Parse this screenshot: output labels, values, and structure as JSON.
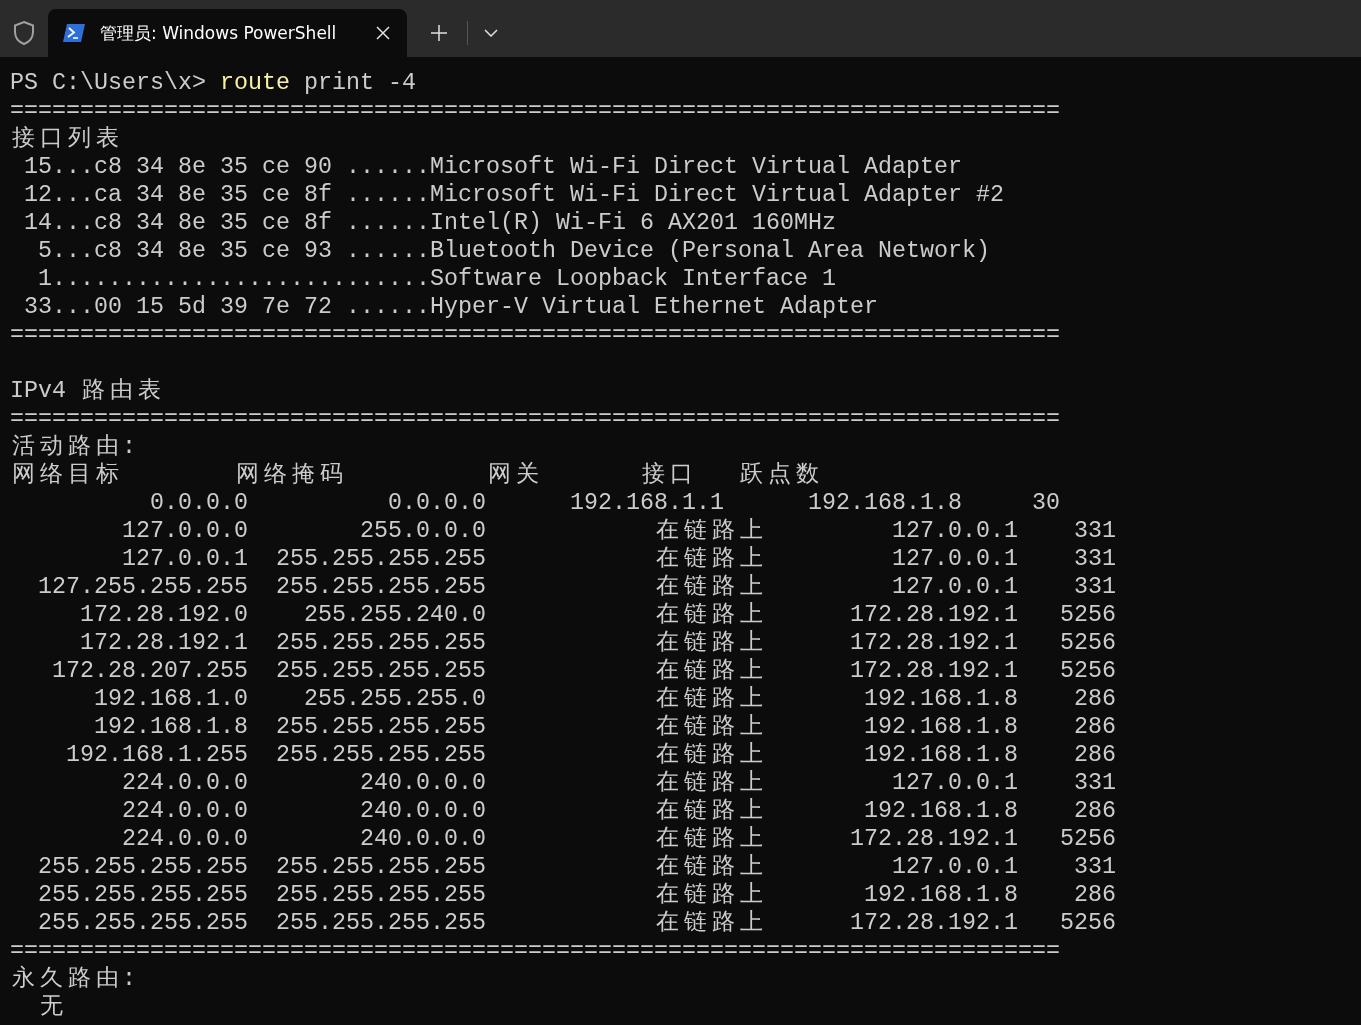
{
  "tabs": [
    {
      "title": "管理员: Windows PowerShell",
      "selected": true
    }
  ],
  "prompt": {
    "path": "PS C:\\Users\\x>",
    "command": "route",
    "args": "print -4"
  },
  "output": [
    {
      "kind": "text",
      "text": "==========================================================================="
    },
    {
      "kind": "text",
      "text": "接口列表"
    },
    {
      "kind": "text",
      "text": " 15...c8 34 8e 35 ce 90 ......Microsoft Wi-Fi Direct Virtual Adapter"
    },
    {
      "kind": "text",
      "text": " 12...ca 34 8e 35 ce 8f ......Microsoft Wi-Fi Direct Virtual Adapter #2"
    },
    {
      "kind": "text",
      "text": " 14...c8 34 8e 35 ce 8f ......Intel(R) Wi-Fi 6 AX201 160MHz"
    },
    {
      "kind": "text",
      "text": "  5...c8 34 8e 35 ce 93 ......Bluetooth Device (Personal Area Network)"
    },
    {
      "kind": "text",
      "text": "  1...........................Software Loopback Interface 1"
    },
    {
      "kind": "text",
      "text": " 33...00 15 5d 39 7e 72 ......Hyper-V Virtual Ethernet Adapter"
    },
    {
      "kind": "text",
      "text": "==========================================================================="
    },
    {
      "kind": "blank"
    },
    {
      "kind": "text",
      "text": "IPv4 路由表"
    },
    {
      "kind": "text",
      "text": "==========================================================================="
    },
    {
      "kind": "text",
      "text": "活动路由:"
    },
    {
      "kind": "header",
      "cells": [
        "网络目标",
        "网络掩码",
        "网关",
        "接口",
        "跃点数"
      ]
    },
    {
      "kind": "text",
      "text": "          0.0.0.0          0.0.0.0      192.168.1.1      192.168.1.8     30"
    },
    {
      "kind": "text",
      "text": "        127.0.0.0        255.0.0.0            在链路上         127.0.0.1    331"
    },
    {
      "kind": "text",
      "text": "        127.0.0.1  255.255.255.255            在链路上         127.0.0.1    331"
    },
    {
      "kind": "text",
      "text": "  127.255.255.255  255.255.255.255            在链路上         127.0.0.1    331"
    },
    {
      "kind": "text",
      "text": "     172.28.192.0    255.255.240.0            在链路上      172.28.192.1   5256"
    },
    {
      "kind": "text",
      "text": "     172.28.192.1  255.255.255.255            在链路上      172.28.192.1   5256"
    },
    {
      "kind": "text",
      "text": "   172.28.207.255  255.255.255.255            在链路上      172.28.192.1   5256"
    },
    {
      "kind": "text",
      "text": "      192.168.1.0    255.255.255.0            在链路上       192.168.1.8    286"
    },
    {
      "kind": "text",
      "text": "      192.168.1.8  255.255.255.255            在链路上       192.168.1.8    286"
    },
    {
      "kind": "text",
      "text": "    192.168.1.255  255.255.255.255            在链路上       192.168.1.8    286"
    },
    {
      "kind": "text",
      "text": "        224.0.0.0        240.0.0.0            在链路上         127.0.0.1    331"
    },
    {
      "kind": "text",
      "text": "        224.0.0.0        240.0.0.0            在链路上       192.168.1.8    286"
    },
    {
      "kind": "text",
      "text": "        224.0.0.0        240.0.0.0            在链路上      172.28.192.1   5256"
    },
    {
      "kind": "text",
      "text": "  255.255.255.255  255.255.255.255            在链路上         127.0.0.1    331"
    },
    {
      "kind": "text",
      "text": "  255.255.255.255  255.255.255.255            在链路上       192.168.1.8    286"
    },
    {
      "kind": "text",
      "text": "  255.255.255.255  255.255.255.255            在链路上      172.28.192.1   5256"
    },
    {
      "kind": "text",
      "text": "==========================================================================="
    },
    {
      "kind": "text",
      "text": "永久路由:"
    },
    {
      "kind": "text",
      "text": "  无"
    }
  ]
}
